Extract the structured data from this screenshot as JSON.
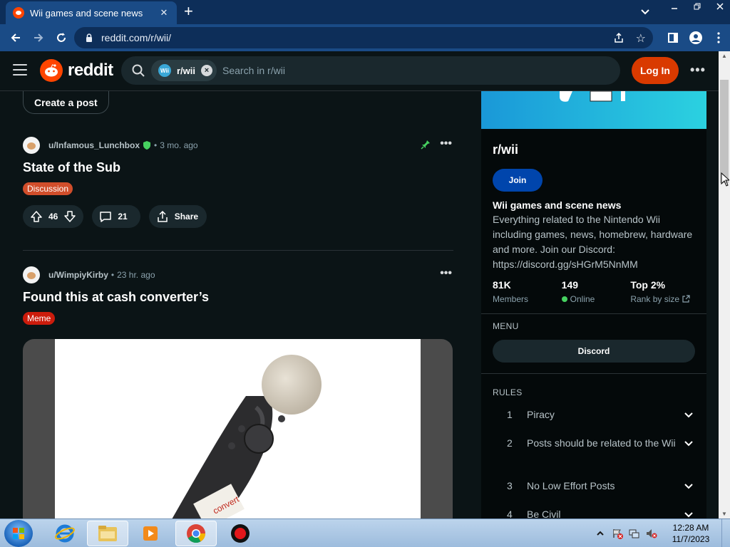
{
  "browser": {
    "tab_title": "Wii games and scene news",
    "tab_close": "✕",
    "new_tab": "+",
    "url": "reddit.com/r/wii/"
  },
  "header": {
    "wordmark": "reddit",
    "chip_icon_text": "Wii",
    "chip_label": "r/wii",
    "chip_clear": "×",
    "search_placeholder": "Search in r/wii",
    "login_label": "Log In",
    "more": "•••"
  },
  "feed": {
    "create_post": "Create a post",
    "posts": [
      {
        "author": "u/Infamous_Lunchbox",
        "dot": "•",
        "age": "3 mo. ago",
        "more": "•••",
        "title": "State of the Sub",
        "flair": "Discussion",
        "flair_color": "#d14e2b",
        "votes": "46",
        "comments": "21",
        "share": "Share"
      },
      {
        "author": "u/WimpiyKirby",
        "dot": "•",
        "age": "23 hr. ago",
        "more": "•••",
        "title": "Found this at cash converter’s",
        "flair": "Meme",
        "flair_color": "#cc1c0c"
      }
    ]
  },
  "sidebar": {
    "name": "r/wii",
    "join": "Join",
    "title": "Wii games and scene news",
    "description": "Everything related to the Nintendo Wii including games, news, homebrew, hardware and more. Join our Discord: https://discord.gg/sHGrM5NnMM",
    "stats": {
      "members_value": "81K",
      "members_label": "Members",
      "online_value": "149",
      "online_label": "Online",
      "rank_value": "Top 2%",
      "rank_label": "Rank by size"
    },
    "menu_label": "MENU",
    "discord": "Discord",
    "rules_label": "RULES",
    "rules": [
      {
        "num": "1",
        "text": "Piracy"
      },
      {
        "num": "2",
        "text": "Posts should be related to the Wii"
      },
      {
        "num": "3",
        "text": "No Low Effort Posts"
      },
      {
        "num": "4",
        "text": "Be Civil"
      }
    ]
  },
  "taskbar": {
    "time": "12:28 AM",
    "date": "11/7/2023"
  },
  "colors": {
    "reddit_orange": "#ff4500",
    "login_bg": "#d93a00",
    "join_bg": "#0045ac",
    "page_bg": "#0b1416",
    "online_green": "#46d160"
  }
}
